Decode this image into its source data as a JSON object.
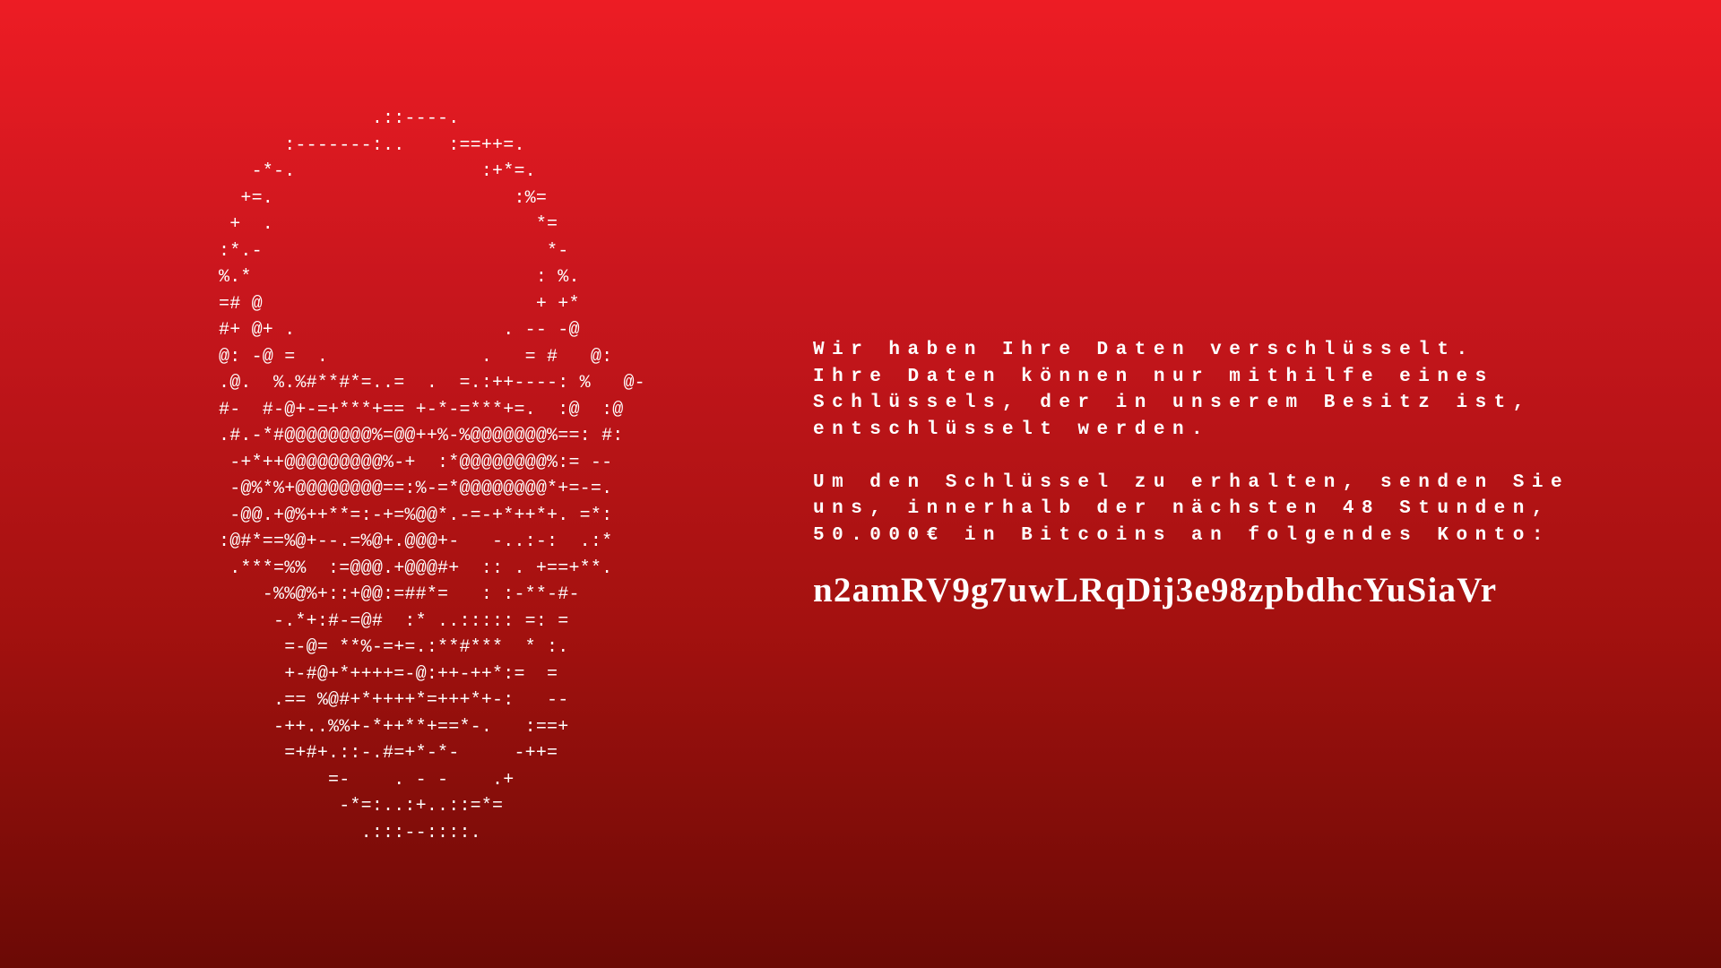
{
  "ransom_note": {
    "ascii_art": "              .::----.\n      :-------:..    :==++=.\n   -*-.                 :+*=.\n  +=.                      :%=\n +  .                        *=\n:*.-                          *-\n%.*                          : %.\n=# @                         + +*\n#+ @+ .                   . -- -@\n@: -@ =  .              .   = #   @:\n.@.  %.%#**#*=..=  .  =.:++----: %   @-\n#-  #-@+-=+***+== +-*-=***+=.  :@  :@\n.#.-*#@@@@@@@@%=@@++%-%@@@@@@@%==: #:\n -+*++@@@@@@@@@%-+  :*@@@@@@@@%:= --\n -@%*%+@@@@@@@@==:%-=*@@@@@@@@*+=-=.\n -@@.+@%++**=:-+=%@@*.-=-+*++*+. =*:\n:@#*==%@+--.=%@+.@@@+-   -..:-:  .:*\n .***=%%  :=@@@.+@@@#+  :: . +==+**.\n    -%%@%+::+@@:=##*=   : :-**-#-\n     -.*+:#-=@#  :* ..::::: =: =\n      =-@= **%-=+=.:**#***  * :.\n      +-#@+*++++=-@:++-++*:=  =\n     .== %@#+*++++*=+++*+-:   --\n     -++..%%+-*++**+==*-.   :==+\n      =+#+.::-.#=+*-*-     -++=\n          =-    . - -    .+\n           -*=:..:+..::=*=\n             .:::--::::.",
    "paragraphs": [
      "Wir haben Ihre Daten verschlüsselt.\nIhre Daten können nur mithilfe eines\nSchlüssels, der in unserem Besitz ist,\nentschlüsselt werden.",
      "Um den Schlüssel zu erhalten, senden Sie\nuns, innerhalb der nächsten 48 Stunden,\n50.000€ in Bitcoins an folgendes Konto:"
    ],
    "wallet_address": "n2amRV9g7uwLRqDij3e98zpbdhcYuSiaVr"
  },
  "colors": {
    "background_top": "#ed1c24",
    "background_bottom": "#6b0a05",
    "text": "#ffffff"
  }
}
